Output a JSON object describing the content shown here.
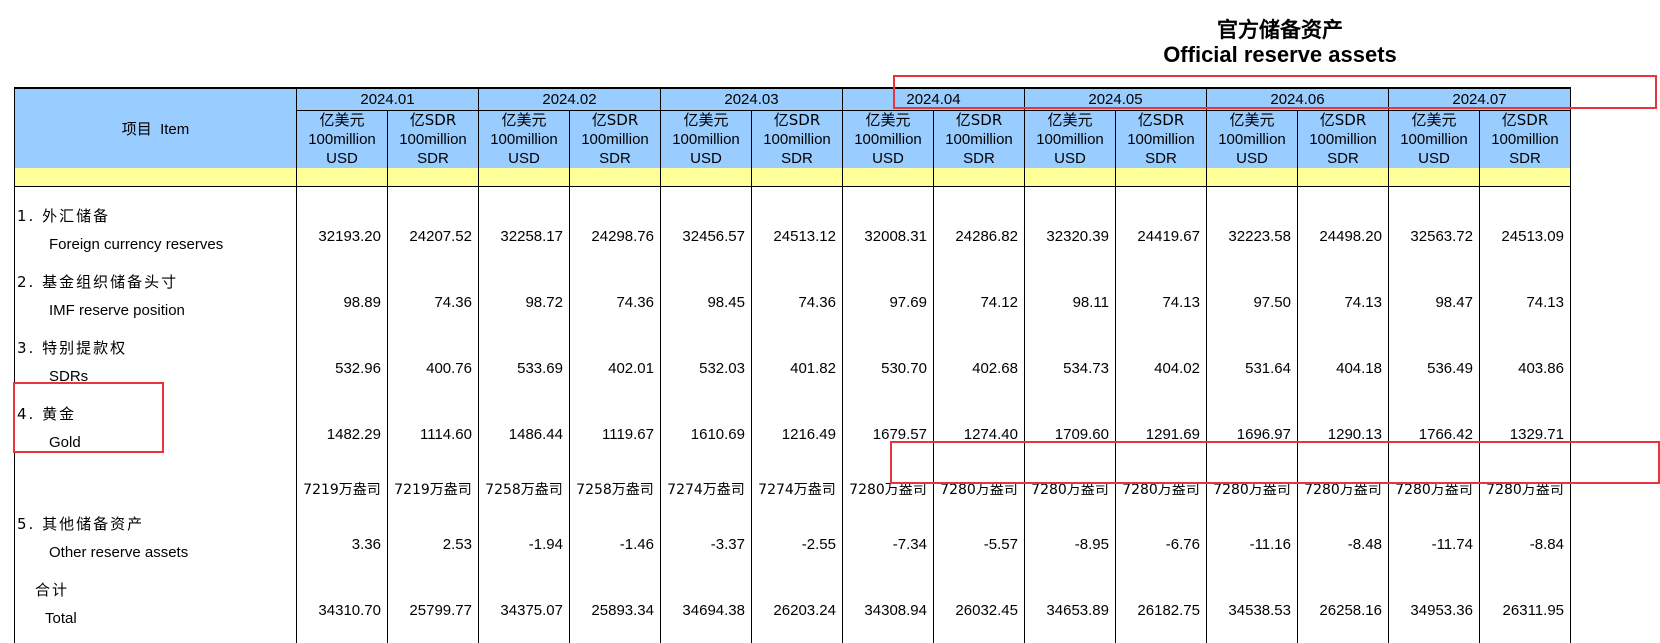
{
  "title": {
    "zh": "官方储备资产",
    "en": "Official reserve assets"
  },
  "header": {
    "item_zh": "项目",
    "item_en": "Item",
    "months": [
      "2024.01",
      "2024.02",
      "2024.03",
      "2024.04",
      "2024.05",
      "2024.06",
      "2024.07"
    ],
    "usd": {
      "zh": "亿美元",
      "line2": "100million",
      "line3": "USD"
    },
    "sdr": {
      "zh": "亿SDR",
      "line2": "100million",
      "line3": "SDR"
    }
  },
  "rows": [
    {
      "zh": "1. 外汇储备",
      "en": "Foreign currency reserves",
      "values": [
        "32193.20",
        "24207.52",
        "32258.17",
        "24298.76",
        "32456.57",
        "24513.12",
        "32008.31",
        "24286.82",
        "32320.39",
        "24419.67",
        "32223.58",
        "24498.20",
        "32563.72",
        "24513.09"
      ]
    },
    {
      "zh": "2. 基金组织储备头寸",
      "en": "IMF reserve position",
      "values": [
        "98.89",
        "74.36",
        "98.72",
        "74.36",
        "98.45",
        "74.36",
        "97.69",
        "74.12",
        "98.11",
        "74.13",
        "97.50",
        "74.13",
        "98.47",
        "74.13"
      ]
    },
    {
      "zh": "3. 特别提款权",
      "en": "SDRs",
      "values": [
        "532.96",
        "400.76",
        "533.69",
        "402.01",
        "532.03",
        "401.82",
        "530.70",
        "402.68",
        "534.73",
        "404.02",
        "531.64",
        "404.18",
        "536.49",
        "403.86"
      ]
    },
    {
      "zh": "4. 黄金",
      "en": "Gold",
      "values": [
        "1482.29",
        "1114.60",
        "1486.44",
        "1119.67",
        "1610.69",
        "1216.49",
        "1679.57",
        "1274.40",
        "1709.60",
        "1291.69",
        "1696.97",
        "1290.13",
        "1766.42",
        "1329.71"
      ]
    },
    {
      "zh": "",
      "en": "",
      "values": [
        "7219万盎司",
        "7219万盎司",
        "7258万盎司",
        "7258万盎司",
        "7274万盎司",
        "7274万盎司",
        "7280万盎司",
        "7280万盎司",
        "7280万盎司",
        "7280万盎司",
        "7280万盎司",
        "7280万盎司",
        "7280万盎司",
        "7280万盎司"
      ]
    },
    {
      "zh": "5. 其他储备资产",
      "en": "Other reserve assets",
      "values": [
        "3.36",
        "2.53",
        "-1.94",
        "-1.46",
        "-3.37",
        "-2.55",
        "-7.34",
        "-5.57",
        "-8.95",
        "-6.76",
        "-11.16",
        "-8.48",
        "-11.74",
        "-8.84"
      ]
    },
    {
      "zh": "合计",
      "en": "Total",
      "values": [
        "34310.70",
        "25799.77",
        "34375.07",
        "25893.34",
        "34694.38",
        "26203.24",
        "34308.94",
        "26032.45",
        "34653.89",
        "26182.75",
        "34538.53",
        "26258.16",
        "34953.36",
        "26311.95"
      ]
    }
  ],
  "colors": {
    "header_bg": "#99ccff",
    "band_bg": "#ffff99",
    "highlight": "#e8353d"
  }
}
